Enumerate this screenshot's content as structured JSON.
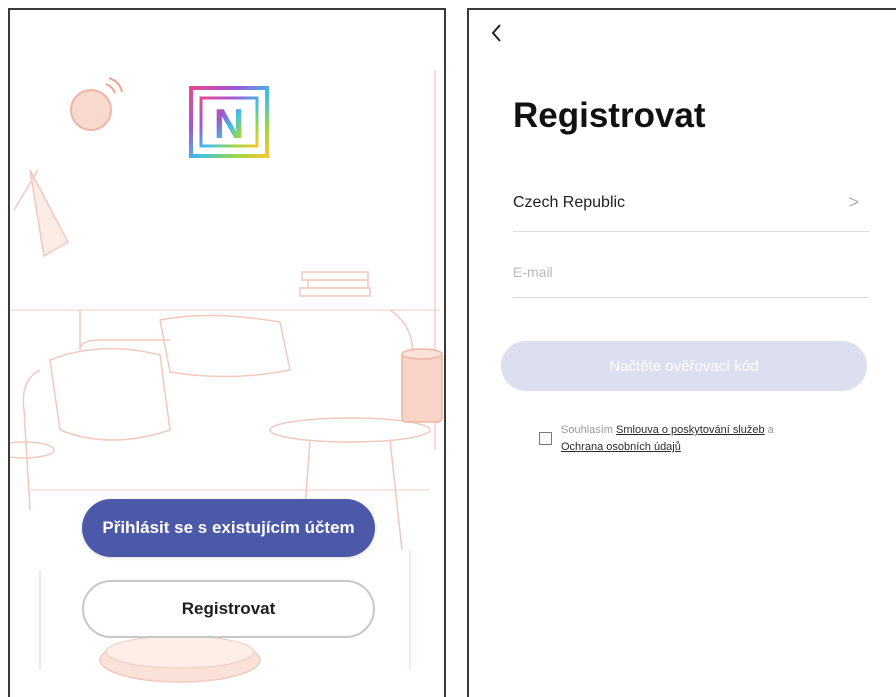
{
  "left_screen": {
    "logo": {
      "letter": "N"
    },
    "login_button": "Přihlásit se s existujícím účtem",
    "register_button": "Registrovat"
  },
  "right_screen": {
    "back_icon": "chevron-left-icon",
    "title": "Registrovat",
    "country": {
      "value": "Czech Republic",
      "chevron": ">"
    },
    "email": {
      "placeholder": "E-mail",
      "value": ""
    },
    "get_code_button": "Načtěte ověřovací kód",
    "agreement": {
      "prefix": "Souhlasím ",
      "terms_link": "Smlouva o poskytování služeb",
      "conjunction": " a",
      "privacy_link": "Ochrana osobních údajů",
      "checked": false
    }
  },
  "colors": {
    "primary": "#4b59a8",
    "primary_disabled": "#dcdff0",
    "illustration_line": "#f3c7bb"
  }
}
